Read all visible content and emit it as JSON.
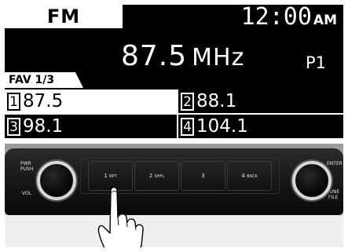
{
  "display": {
    "band": "FM",
    "clock": {
      "time": "12:00",
      "ampm": "AM"
    },
    "frequency": {
      "value": "87.5",
      "unit": "MHz"
    },
    "preset_indicator": "P1",
    "fav_page": "FAV 1/3",
    "presets": [
      {
        "num": "1",
        "value": "87.5",
        "selected": true
      },
      {
        "num": "2",
        "value": "88.1",
        "selected": false
      },
      {
        "num": "3",
        "value": "98.1",
        "selected": false
      },
      {
        "num": "4",
        "value": "104.1",
        "selected": false
      }
    ]
  },
  "panel": {
    "left_knob_top_label": "PWR\nPUSH",
    "left_knob_bottom_label": "VOL",
    "right_knob_top_label": "ENTER",
    "right_knob_bottom_label": "TUNE\nFILE",
    "buttons": [
      {
        "num": "1",
        "label": "RPT"
      },
      {
        "num": "2",
        "label": "SHFL"
      },
      {
        "num": "3",
        "label": ""
      },
      {
        "num": "4",
        "label": "BACK"
      }
    ]
  },
  "colors": {
    "display_bg": "#000000",
    "display_fg": "#ffffff",
    "panel_bg": "#141414"
  }
}
